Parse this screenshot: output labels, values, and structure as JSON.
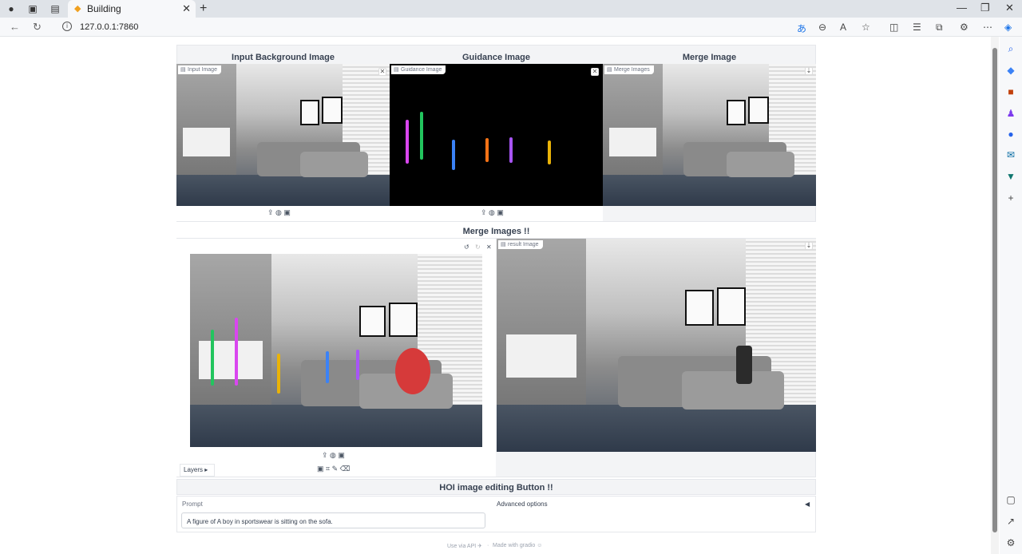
{
  "browser": {
    "tab_title": "Building",
    "url": "127.0.0.1:7860"
  },
  "page": {
    "input_title": "Input Background Image",
    "guidance_title": "Guidance Image",
    "merge_title": "Merge Image",
    "input_label": "Input Image",
    "guidance_label": "Guidance Image",
    "merge_label": "Merge Images",
    "merge_button_label": "Merge Images !!",
    "result_label": "result Image",
    "layers_label": "Layers",
    "hoi_button_label": "HOI image editing Button !!",
    "prompt_label": "Prompt",
    "prompt_value": "A figure of A boy in sportswear is sitting on the sofa.",
    "advanced_label": "Advanced options",
    "footer_api": "Use via API",
    "footer_made": "Made with gradio"
  },
  "colors": {
    "panel_bg": "#f3f4f6",
    "red_marker": "#d63a3a"
  }
}
